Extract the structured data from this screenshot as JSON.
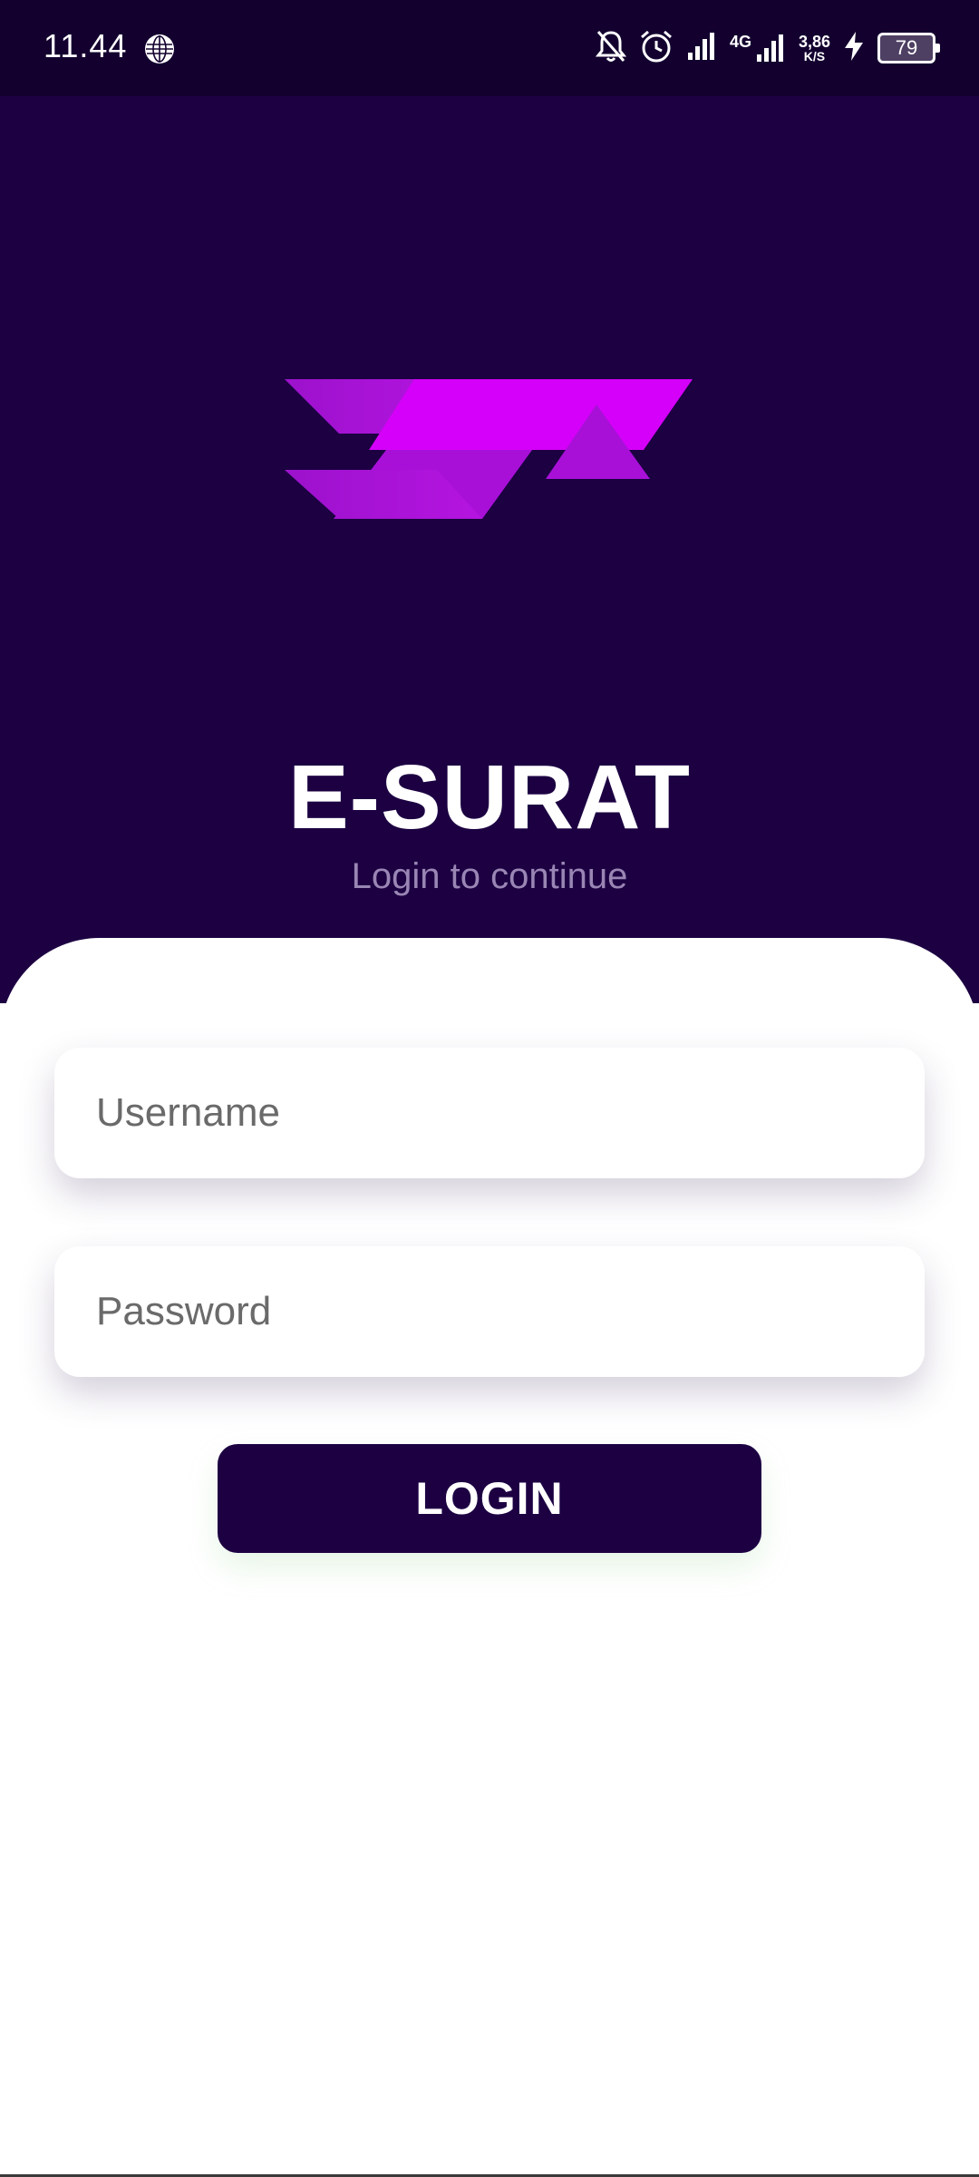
{
  "status_bar": {
    "time": "11.44",
    "network_type": "4G",
    "speed_value": "3,86",
    "speed_unit": "K/S",
    "battery": "79",
    "icons": [
      "globe-icon",
      "bell-off-icon",
      "alarm-icon",
      "signal-icon",
      "signal-4g-icon",
      "charging-icon",
      "battery-icon"
    ]
  },
  "header": {
    "logo": "e-surat-logo",
    "title": "E-SURAT",
    "subtitle": "Login to continue"
  },
  "form": {
    "username_placeholder": "Username",
    "username_value": "",
    "password_placeholder": "Password",
    "password_value": "",
    "login_label": "LOGIN"
  },
  "colors": {
    "status_bar_bg": "#13002f",
    "header_bg": "#1c0042",
    "accent_magenta": "#d500f9",
    "accent_purple": "#a010d0",
    "subtitle_text": "#9a86b4",
    "button_bg": "#1c0042"
  }
}
